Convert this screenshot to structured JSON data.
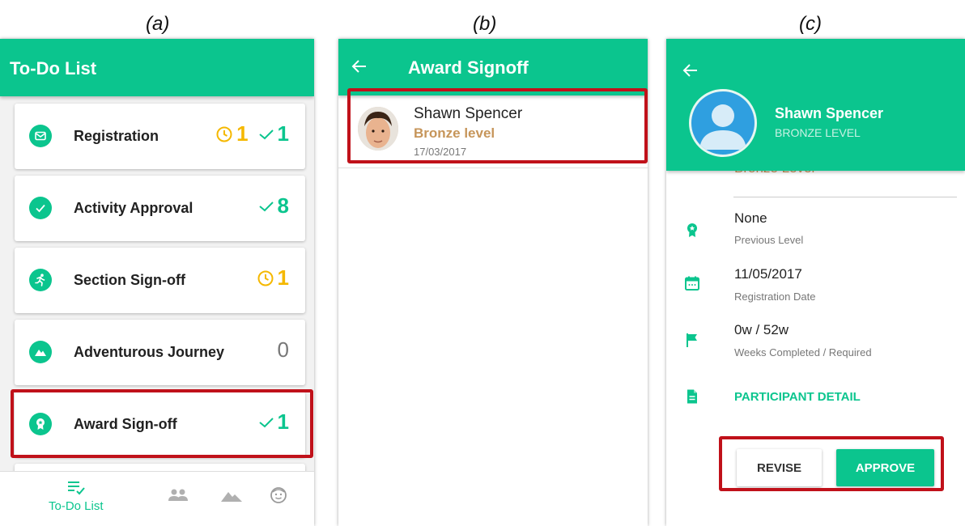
{
  "captions": {
    "a": "(a)",
    "b": "(b)",
    "c": "(c)"
  },
  "colors": {
    "accent": "#0bc58e",
    "pending": "#f5b800",
    "highlight": "#c0111a",
    "bronze": "#c6955a"
  },
  "todo": {
    "title": "To-Do List",
    "items": [
      {
        "label": "Registration",
        "icon": "mail-icon",
        "pending": "1",
        "done": "1"
      },
      {
        "label": "Activity Approval",
        "icon": "check-circle-icon",
        "done": "8"
      },
      {
        "label": "Section Sign-off",
        "icon": "runner-icon",
        "pending": "1"
      },
      {
        "label": "Adventurous Journey",
        "icon": "mountain-icon",
        "count": "0"
      },
      {
        "label": "Award Sign-off",
        "icon": "award-icon",
        "done": "1"
      }
    ],
    "nav": {
      "active_label": "To-Do List"
    }
  },
  "signoff": {
    "title": "Award Signoff",
    "participant": {
      "name": "Shawn Spencer",
      "level": "Bronze level",
      "date": "17/03/2017"
    }
  },
  "detail": {
    "name": "Shawn Spencer",
    "level_caps": "BRONZE LEVEL",
    "peek_text": "Bronze Level",
    "rows": [
      {
        "value": "None",
        "label": "Previous Level",
        "icon": "award-icon"
      },
      {
        "value": "11/05/2017",
        "label": "Registration Date",
        "icon": "calendar-icon"
      },
      {
        "value": "0w / 52w",
        "label": "Weeks Completed / Required",
        "icon": "flag-icon"
      }
    ],
    "link": "PARTICIPANT DETAIL",
    "revise": "REVISE",
    "approve": "APPROVE"
  }
}
